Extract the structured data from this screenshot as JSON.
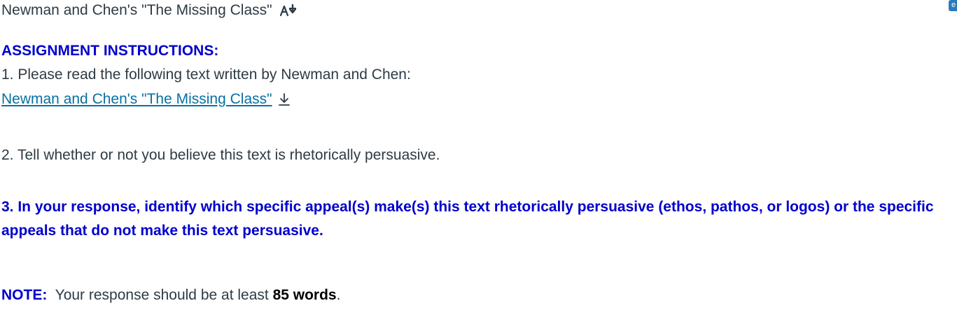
{
  "title": "Newman and Chen's \"The Missing Class\"",
  "title_icon": "translate-icon",
  "corner_badge": "e",
  "instructions_heading": "ASSIGNMENT INSTRUCTIONS:",
  "step1": "1. Please read the following text written by Newman and Chen:",
  "file_link": {
    "label": "Newman and Chen's \"The Missing Class\"",
    "icon": "download-icon"
  },
  "step2": "2.  Tell whether or not you believe this text is rhetorically persuasive.",
  "step3": "3.  In your response, identify which specific appeal(s) make(s) this text rhetorically persuasive (ethos, pathos, or logos) or the specific appeals that do not make this text persuasive.",
  "note": {
    "label": "NOTE:",
    "text_before": "  Your response should be at least ",
    "bold": "85 words",
    "text_after": "."
  },
  "colors": {
    "accent_blue": "#0000cc",
    "link": "#0770a3",
    "text": "#2d3b45",
    "badge": "#2b7abc"
  }
}
